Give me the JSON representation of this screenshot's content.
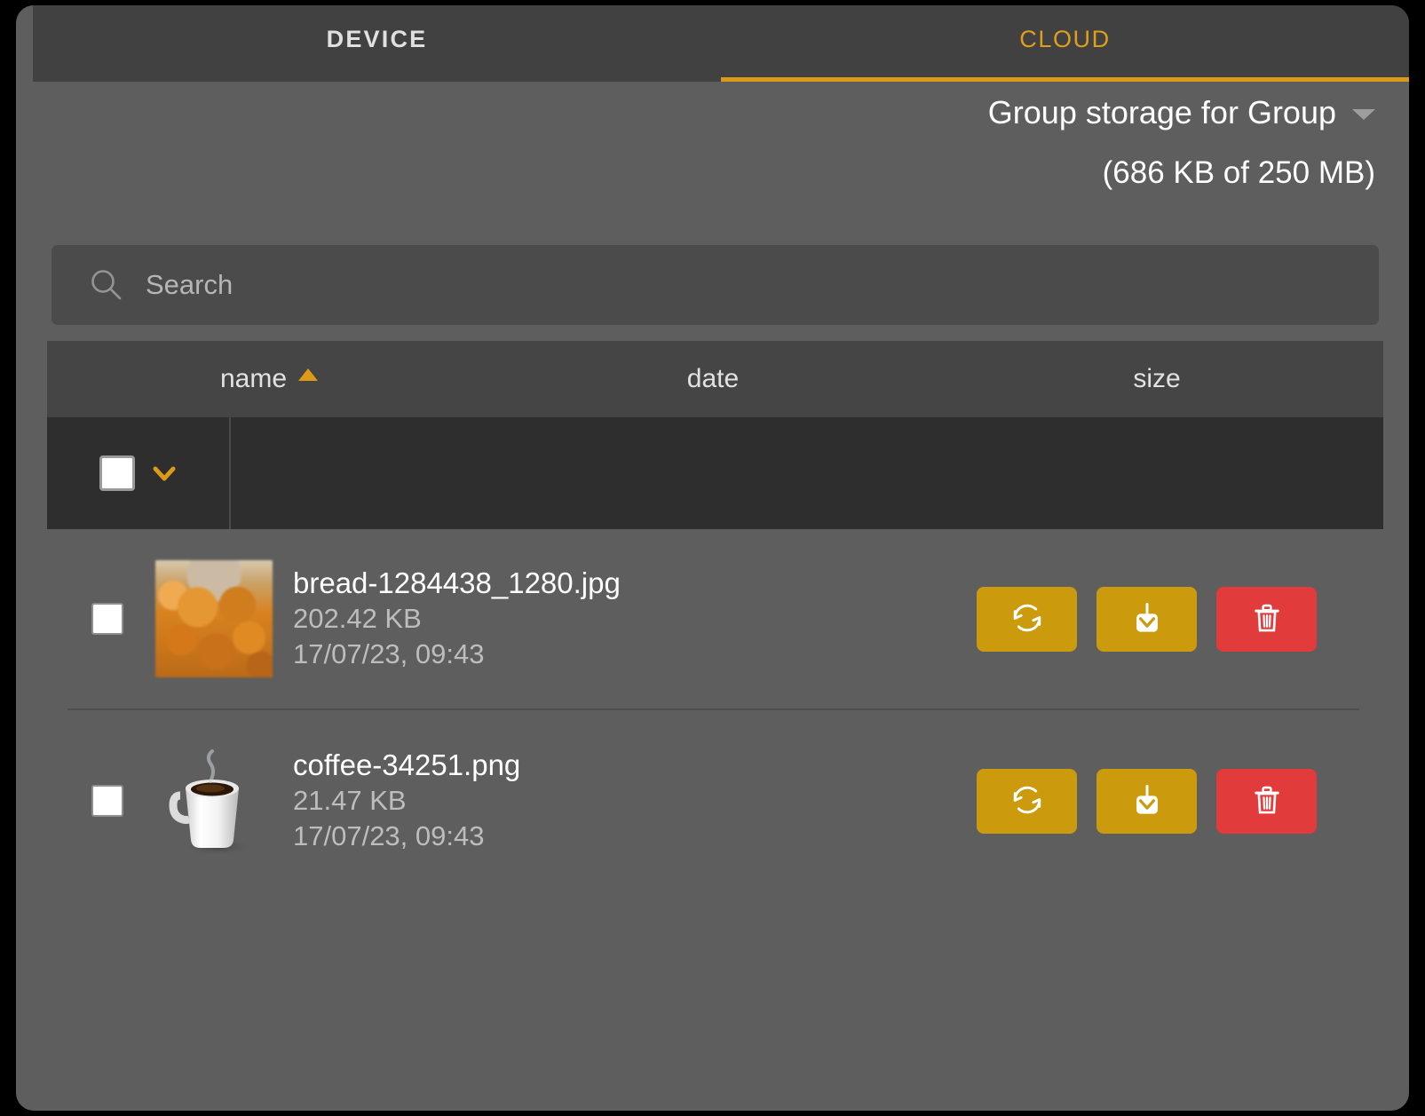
{
  "tabs": [
    {
      "label": "DEVICE",
      "active": false
    },
    {
      "label": "CLOUD",
      "active": true
    }
  ],
  "header": {
    "storage_title": "Group storage for Group",
    "storage_quota": "(686 KB of 250 MB)",
    "dropdown_icon": "chevron-down-icon"
  },
  "search": {
    "placeholder": "Search",
    "value": "",
    "icon": "search-icon"
  },
  "table": {
    "columns": [
      {
        "label": "name",
        "sorted": "asc"
      },
      {
        "label": "date",
        "sorted": ""
      },
      {
        "label": "size",
        "sorted": ""
      }
    ],
    "select_all_checked": false,
    "select_all_menu_icon": "chevron-down-icon"
  },
  "files": [
    {
      "name": "bread-1284438_1280.jpg",
      "size": "202.42 KB",
      "date": "17/07/23, 09:43",
      "checked": false,
      "thumbnail": "bread-thumbnail",
      "actions": [
        {
          "name": "sync-button",
          "icon": "sync-icon",
          "color": "#cc9a0d"
        },
        {
          "name": "download-button",
          "icon": "download-icon",
          "color": "#cc9a0d"
        },
        {
          "name": "delete-button",
          "icon": "trash-icon",
          "color": "#e23b3b"
        }
      ]
    },
    {
      "name": "coffee-34251.png",
      "size": "21.47 KB",
      "date": "17/07/23, 09:43",
      "checked": false,
      "thumbnail": "coffee-cup-thumbnail",
      "actions": [
        {
          "name": "sync-button",
          "icon": "sync-icon",
          "color": "#cc9a0d"
        },
        {
          "name": "download-button",
          "icon": "download-icon",
          "color": "#cc9a0d"
        },
        {
          "name": "delete-button",
          "icon": "trash-icon",
          "color": "#e23b3b"
        }
      ]
    }
  ],
  "colors": {
    "accent": "#d99a15",
    "tab_active_text": "#e09f1a",
    "tabbar_bg": "#414141",
    "panel_bg": "#5e5e5e",
    "table_header_bg": "#454545",
    "select_toolbar_bg": "#2e2e2e",
    "action_gold": "#cc9a0d",
    "action_red": "#e23b3b"
  }
}
